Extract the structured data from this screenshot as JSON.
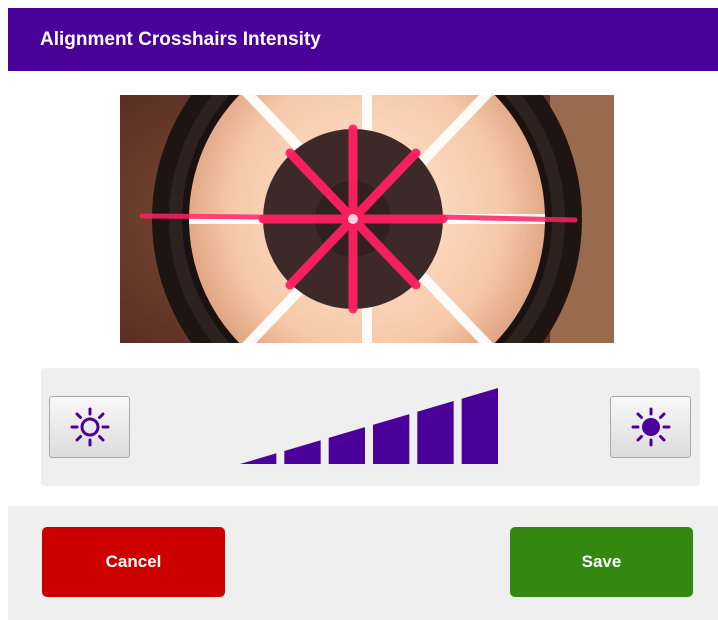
{
  "dialog": {
    "title": "Alignment Crosshairs Intensity"
  },
  "camera_view": {
    "description_icon": "crosshair-camera-image"
  },
  "intensity": {
    "decrease_icon": "sun-outline-icon",
    "increase_icon": "sun-filled-icon",
    "level": 6,
    "max_level": 6,
    "bar_color": "#4a0099"
  },
  "footer": {
    "cancel_label": "Cancel",
    "save_label": "Save"
  },
  "colors": {
    "header": "#4a0099",
    "cancel": "#cc0000",
    "save": "#338811",
    "panel": "#efefef"
  }
}
